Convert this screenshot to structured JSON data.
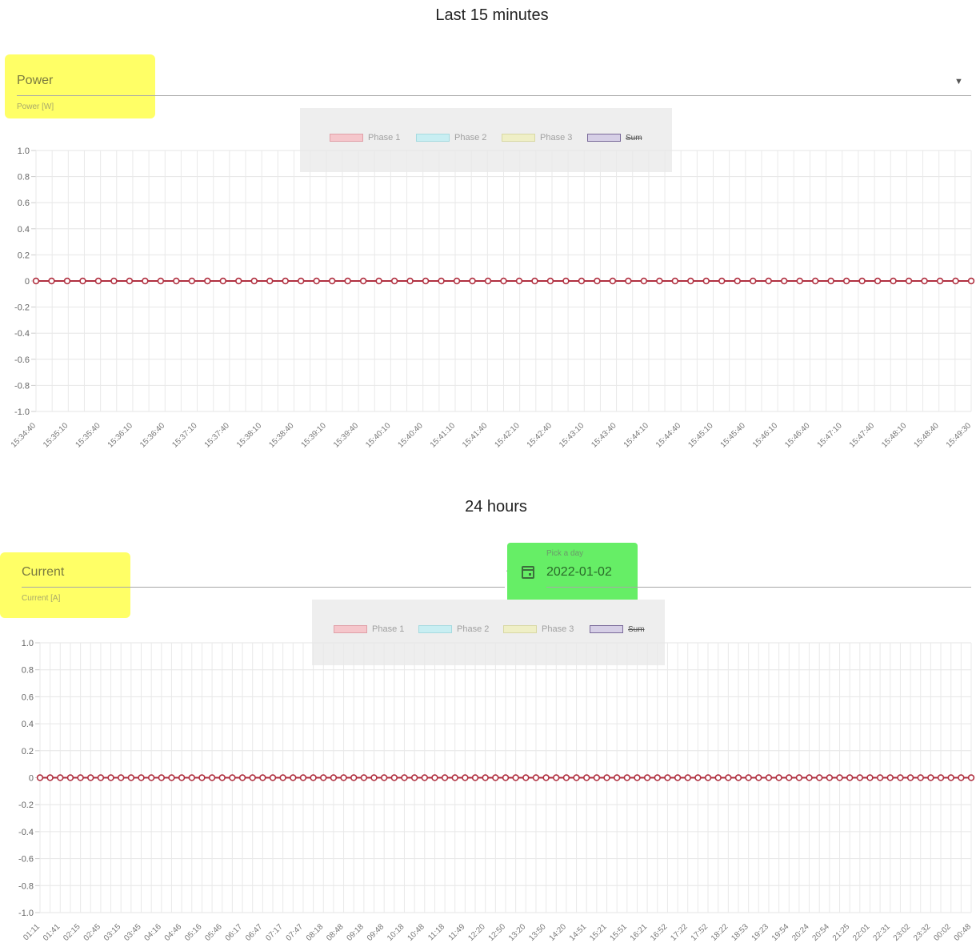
{
  "sections": {
    "top": {
      "title": "Last 15 minutes",
      "select": {
        "value": "Power",
        "hint": "Power [W]"
      },
      "legend": [
        {
          "label": "Phase 1",
          "fill": "#f5c6cb",
          "stroke": "#e0a0a8"
        },
        {
          "label": "Phase 2",
          "fill": "#c8eef2",
          "stroke": "#a6dbe0"
        },
        {
          "label": "Phase 3",
          "fill": "#efefc6",
          "stroke": "#d8d8a4"
        },
        {
          "label": "Sum",
          "fill": "#d6cfe6",
          "stroke": "#7a6a9a",
          "hidden": true
        }
      ]
    },
    "bottom": {
      "title": "24 hours",
      "select": {
        "value": "Current",
        "hint": "Current [A]"
      },
      "date": {
        "label": "Pick a day",
        "value": "2022-01-02"
      },
      "legend": [
        {
          "label": "Phase 1",
          "fill": "#f5c6cb",
          "stroke": "#e0a0a8"
        },
        {
          "label": "Phase 2",
          "fill": "#c8eef2",
          "stroke": "#a6dbe0"
        },
        {
          "label": "Phase 3",
          "fill": "#efefc6",
          "stroke": "#d8d8a4"
        },
        {
          "label": "Sum",
          "fill": "#d6cfe6",
          "stroke": "#7a6a9a",
          "hidden": true
        }
      ]
    }
  },
  "chart_data": [
    {
      "type": "line",
      "title": "Last 15 minutes",
      "ylabel": "Power [W]",
      "ylim": [
        -1.0,
        1.0
      ],
      "yticks": [
        "1.0",
        "0.8",
        "0.6",
        "0.4",
        "0.2",
        "0",
        "-0.2",
        "-0.4",
        "-0.6",
        "-0.8",
        "-1.0"
      ],
      "x": [
        "15:34:40",
        "15:35:10",
        "15:35:40",
        "15:36:10",
        "15:36:40",
        "15:37:10",
        "15:37:40",
        "15:38:10",
        "15:38:40",
        "15:39:10",
        "15:39:40",
        "15:40:10",
        "15:40:40",
        "15:41:10",
        "15:41:40",
        "15:42:10",
        "15:42:40",
        "15:43:10",
        "15:43:40",
        "15:44:10",
        "15:44:40",
        "15:45:10",
        "15:45:40",
        "15:46:10",
        "15:46:40",
        "15:47:10",
        "15:47:40",
        "15:48:10",
        "15:48:40",
        "15:49:30"
      ],
      "points_count": 61,
      "grid": true,
      "series": [
        {
          "name": "Phase 1",
          "value": 0,
          "color": "#b03040"
        },
        {
          "name": "Phase 2",
          "value": 0,
          "color": "#a6dbe0"
        },
        {
          "name": "Phase 3",
          "value": 0,
          "color": "#d8d8a4"
        }
      ]
    },
    {
      "type": "line",
      "title": "24 hours",
      "ylabel": "Current [A]",
      "ylim": [
        -1.0,
        1.0
      ],
      "yticks": [
        "1.0",
        "0.8",
        "0.6",
        "0.4",
        "0.2",
        "0",
        "-0.2",
        "-0.4",
        "-0.6",
        "-0.8",
        "-1.0"
      ],
      "x": [
        "01:11",
        "01:41",
        "02:15",
        "02:45",
        "03:15",
        "03:45",
        "04:16",
        "04:46",
        "05:16",
        "05:46",
        "06:17",
        "06:47",
        "07:17",
        "07:47",
        "08:18",
        "08:48",
        "09:18",
        "09:48",
        "10:18",
        "10:48",
        "11:18",
        "11:49",
        "12:20",
        "12:50",
        "13:20",
        "13:50",
        "14:20",
        "14:51",
        "15:21",
        "15:51",
        "16:21",
        "16:52",
        "17:22",
        "17:52",
        "18:22",
        "18:53",
        "19:23",
        "19:54",
        "20:24",
        "20:54",
        "21:25",
        "22:01",
        "22:31",
        "23:02",
        "23:32",
        "00:02",
        "00:48"
      ],
      "points_count": 93,
      "grid": true,
      "series": [
        {
          "name": "Phase 1",
          "value": 0,
          "color": "#b03040"
        },
        {
          "name": "Phase 2",
          "value": 0,
          "color": "#a6dbe0"
        },
        {
          "name": "Phase 3",
          "value": 0,
          "color": "#d8d8a4"
        }
      ]
    }
  ]
}
